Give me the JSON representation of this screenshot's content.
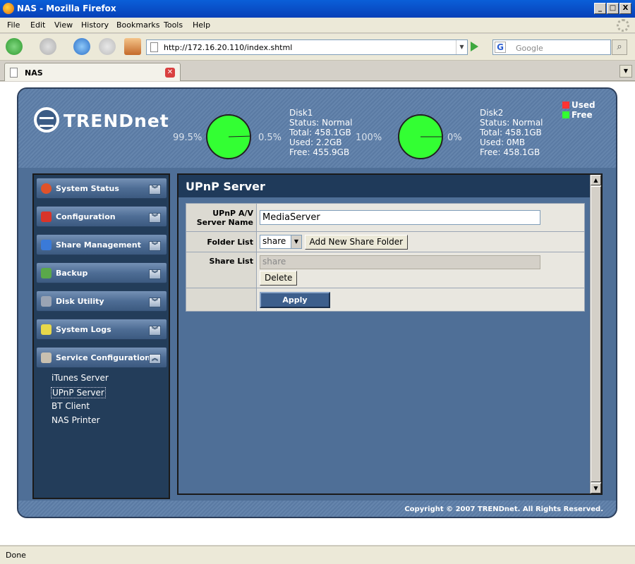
{
  "window": {
    "title": "NAS - Mozilla Firefox",
    "min": "_",
    "max": "□",
    "close": "X"
  },
  "menubar": [
    "File",
    "Edit",
    "View",
    "History",
    "Bookmarks",
    "Tools",
    "Help"
  ],
  "navbar": {
    "url": "http://172.16.20.110/index.shtml",
    "search_placeholder": "Google"
  },
  "tabs": [
    {
      "label": "NAS"
    }
  ],
  "header": {
    "logo": "TRENDnet",
    "disks": [
      {
        "name": "Disk1",
        "status": "Status: Normal",
        "total": "Total: 458.1GB",
        "used": "Used: 2.2GB",
        "free": "Free: 455.9GB",
        "free_pct": "99.5%",
        "used_pct": "0.5%",
        "used_fraction": 0.005
      },
      {
        "name": "Disk2",
        "status": "Status: Normal",
        "total": "Total: 458.1GB",
        "used": "Used: 0MB",
        "free": "Free: 458.1GB",
        "free_pct": "100%",
        "used_pct": "0%",
        "used_fraction": 0.0
      }
    ],
    "legend": {
      "used": "Used",
      "free": "Free",
      "used_color": "#ff3333",
      "free_color": "#33ff33"
    }
  },
  "sidebar": {
    "items": [
      {
        "label": "System Status",
        "icon": "info-icon"
      },
      {
        "label": "Configuration",
        "icon": "toolbox-icon"
      },
      {
        "label": "Share Management",
        "icon": "share-icon"
      },
      {
        "label": "Backup",
        "icon": "backup-icon"
      },
      {
        "label": "Disk Utility",
        "icon": "disk-icon"
      },
      {
        "label": "System Logs",
        "icon": "logs-icon"
      },
      {
        "label": "Service Configuration",
        "icon": "service-icon"
      }
    ],
    "submenu": [
      "iTunes Server",
      "UPnP Server",
      "BT Client",
      "NAS Printer"
    ],
    "active_submenu": "UPnP Server"
  },
  "main": {
    "title": "UPnP Server",
    "name_label": "UPnP A/V Server Name",
    "name_value": "MediaServer",
    "folder_label": "Folder List",
    "folder_selected": "share",
    "add_folder_label": "Add New Share Folder",
    "share_label": "Share List",
    "share_items": [
      "share"
    ],
    "delete_label": "Delete",
    "apply_label": "Apply"
  },
  "footer": {
    "copyright": "Copyright © 2007 TRENDnet. All Rights Reserved."
  },
  "status": {
    "text": "Done"
  }
}
